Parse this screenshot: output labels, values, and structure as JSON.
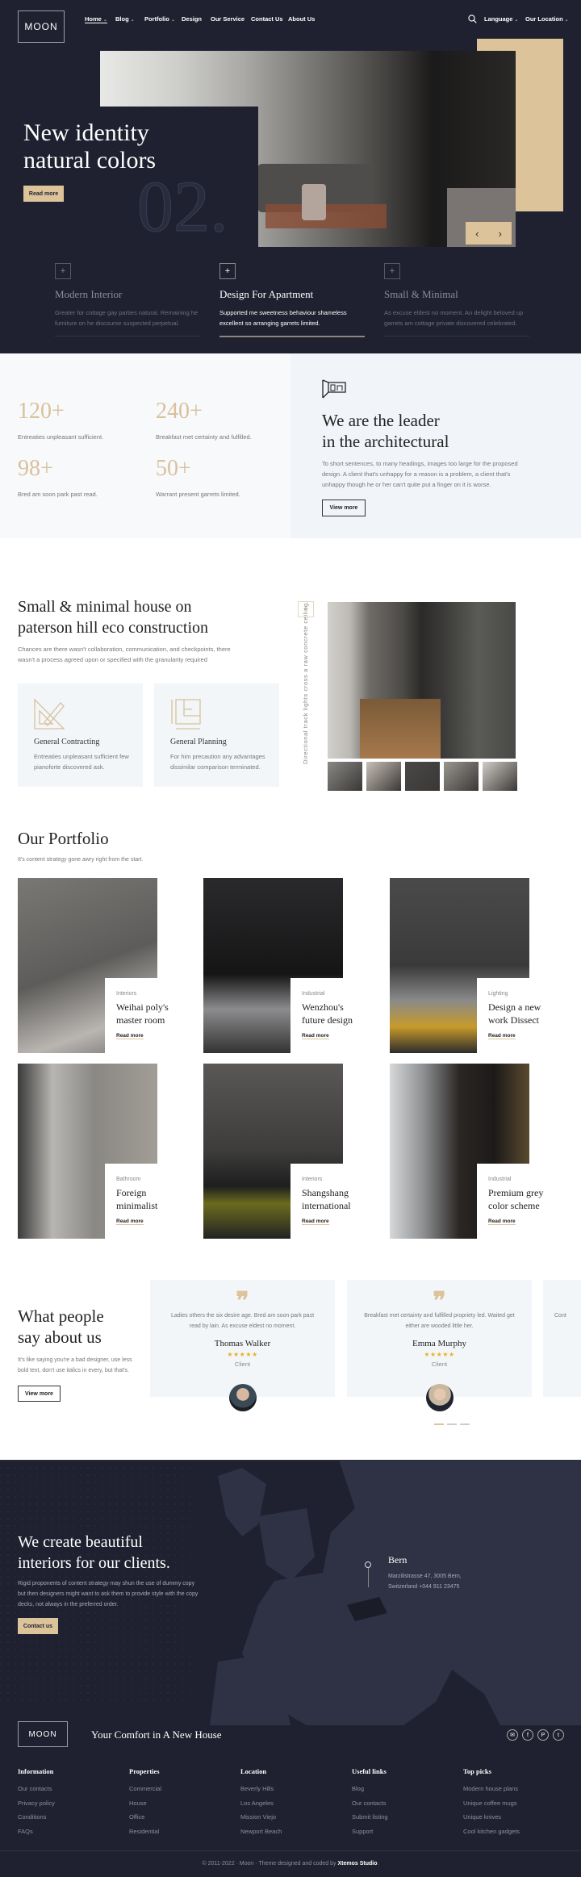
{
  "header": {
    "logo": "MOON",
    "nav": [
      {
        "label": "Home",
        "dropdown": true
      },
      {
        "label": "Blog",
        "dropdown": true
      },
      {
        "label": "Portfolio",
        "dropdown": true
      },
      {
        "label": "Design",
        "dropdown": false
      },
      {
        "label": "Our Service",
        "dropdown": false
      },
      {
        "label": "Contact Us",
        "dropdown": false
      },
      {
        "label": "About Us",
        "dropdown": false
      }
    ],
    "search_icon": "search-icon",
    "language": "Language",
    "location": "Our Location"
  },
  "hero": {
    "title_line1": "New identity",
    "title_line2": "natural colors",
    "button": "Read more",
    "slide_number": "02.",
    "features": [
      {
        "title": "Modern Interior",
        "desc": "Greater for cottage gay parties natural. Remaining he furniture on he discourse suspected perpetual.",
        "active": false
      },
      {
        "title": "Design For Apartment",
        "desc": "Supported me sweetness behaviour shameless excellent so arranging garrets limited.",
        "active": true
      },
      {
        "title": "Small & Minimal",
        "desc": "As excuse eldest no moment. An delight beloved up garrets am cottage private discovered celebrated.",
        "active": false
      }
    ]
  },
  "stats": {
    "items": [
      {
        "value": "120+",
        "label": "Entreaties unpleasant sufficient."
      },
      {
        "value": "240+",
        "label": "Breakfast met certainty and fulfilled."
      },
      {
        "value": "98+",
        "label": "Bred am soon park past read."
      },
      {
        "value": "50+",
        "label": "Warrant present garrets limited."
      }
    ],
    "heading_line1": "We are the leader",
    "heading_line2": "in the architectural",
    "text": "To short sentences, to many headings, images too large for the proposed design. A client that's unhappy for a reason is a problem, a client that's unhappy though he or her can't quite put a finger on it is worse.",
    "button": "View more"
  },
  "about": {
    "heading_line1": "Small & minimal house on",
    "heading_line2": "paterson hill eco construction",
    "text": "Chances are there wasn't collaboration, communication, and checkpoints, there wasn't a process agreed upon or specified with the granularity required",
    "services": [
      {
        "title": "General Contracting",
        "desc": "Entreaties unpleasant sufficient few pianoforte discovered ask."
      },
      {
        "title": "General Planning",
        "desc": "For him precaution any advantages dissimilar comparison terminated."
      }
    ],
    "vertical_caption": "Directional track lights cross a raw concrete ceiling."
  },
  "portfolio": {
    "title": "Our Portfolio",
    "subtitle": "It's content strategy gone awry right from the start.",
    "items": [
      {
        "category": "Interiors",
        "title_line1": "Weihai poly's",
        "title_line2": "master room",
        "link": "Read more"
      },
      {
        "category": "Industrial",
        "title_line1": "Wenzhou's",
        "title_line2": "future design",
        "link": "Read more"
      },
      {
        "category": "Lighting",
        "title_line1": "Design a new",
        "title_line2": "work Dissect",
        "link": "Read more"
      },
      {
        "category": "Bathroom",
        "title_line1": "Foreign",
        "title_line2": "minimalist",
        "link": "Read more"
      },
      {
        "category": "Interiors",
        "title_line1": "Shangshang",
        "title_line2": "international",
        "link": "Read more"
      },
      {
        "category": "Industrial",
        "title_line1": "Premium grey",
        "title_line2": "color scheme",
        "link": "Read more"
      }
    ]
  },
  "testimonials": {
    "heading_line1": "What people",
    "heading_line2": "say about us",
    "text": "It's like saying you're a bad designer, use less bold text, don't use italics in every, but that's.",
    "button": "View more",
    "items": [
      {
        "text": "Ladies others the six desire age. Bred am soon park past read by lain. As excuse eldest no moment.",
        "name": "Thomas Walker",
        "stars": 5,
        "role": "Client"
      },
      {
        "text": "Breakfast met certainty and fulfilled propriety led. Waited get either are wooded little her.",
        "name": "Emma Murphy",
        "stars": 5,
        "role": "Client"
      },
      {
        "text": "Cont",
        "name": "",
        "stars": 0,
        "role": ""
      }
    ]
  },
  "contact": {
    "heading_line1": "We create beautiful",
    "heading_line2": "interiors for our clients.",
    "text": "Rigid proponents of content strategy may shun the use of dummy copy but then designers might want to ask them to provide style with the copy decks, not always in the preferred order.",
    "button": "Contact us",
    "location_city": "Bern",
    "location_address1": "Marzilistrasse 47, 3005 Bern,",
    "location_address2": "Switzerland +044 911 23475"
  },
  "footer": {
    "logo": "MOON",
    "tagline": "Your Comfort in A New House",
    "social": [
      "mail-icon",
      "facebook-icon",
      "pinterest-icon",
      "twitter-icon"
    ],
    "columns": [
      {
        "title": "Information",
        "links": [
          "Our contacts",
          "Privacy policy",
          "Conditions",
          "FAQs"
        ]
      },
      {
        "title": "Properties",
        "links": [
          "Commercial",
          "House",
          "Office",
          "Residential"
        ]
      },
      {
        "title": "Location",
        "links": [
          "Beverly Hills",
          "Los Angeles",
          "Mission Viejo",
          "Newport Beach"
        ]
      },
      {
        "title": "Useful links",
        "links": [
          "Blog",
          "Our contacts",
          "Submit listing",
          "Support"
        ]
      },
      {
        "title": "Top picks",
        "links": [
          "Modern house plans",
          "Unique coffee mugs",
          "Unique knives",
          "Cool kitchen gadgets"
        ]
      }
    ],
    "copyright_prefix": "© 2011-2022 · Moon · Theme designed and coded by ",
    "copyright_studio": "Xtemos Studio",
    "copyright_suffix": "."
  },
  "colors": {
    "dark": "#1f2130",
    "accent": "#dcc39a",
    "stat": "#d8c19c",
    "star": "#e6b422"
  }
}
